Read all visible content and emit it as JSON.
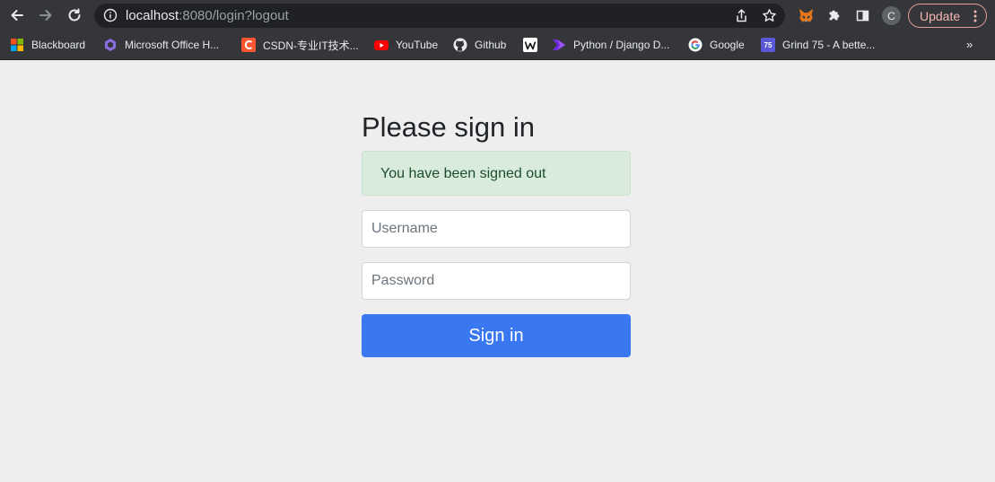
{
  "browser": {
    "url_host": "localhost",
    "url_rest": ":8080/login?logout",
    "update_label": "Update",
    "avatar_initial": "C",
    "bookmarks": [
      {
        "label": "Blackboard",
        "icon": "microsoft-squares-icon"
      },
      {
        "label": "Microsoft Office H...",
        "icon": "office-icon"
      },
      {
        "label": "CSDN-专业IT技术...",
        "icon": "csdn-icon"
      },
      {
        "label": "YouTube",
        "icon": "youtube-icon"
      },
      {
        "label": "Github",
        "icon": "github-icon"
      },
      {
        "label": "",
        "icon": "w-icon"
      },
      {
        "label": "Python / Django D...",
        "icon": "play-icon"
      },
      {
        "label": "Google",
        "icon": "google-icon"
      },
      {
        "label": "Grind 75 - A bette...",
        "icon": "grind75-icon"
      }
    ],
    "grind_badge": "75",
    "more_label": "»"
  },
  "login": {
    "title": "Please sign in",
    "alert": "You have been signed out",
    "username_placeholder": "Username",
    "username_value": "",
    "password_placeholder": "Password",
    "password_value": "",
    "submit_label": "Sign in"
  },
  "colors": {
    "page_bg": "#eeeeee",
    "chrome_bg": "#35363a",
    "primary": "#3a78f2",
    "alert_bg": "#d9ebdc",
    "alert_text": "#1e4d2b"
  }
}
